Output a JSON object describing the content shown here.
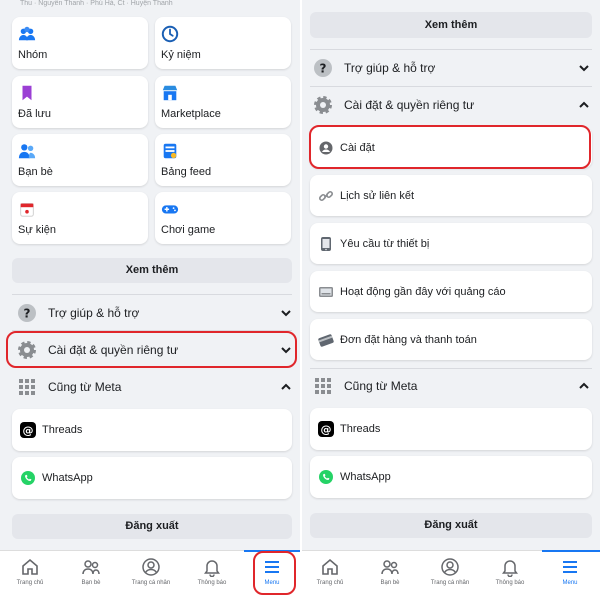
{
  "left": {
    "top_clip_text": "Thu · Nguyễn Thanh · Phú Hà, Ct · Huyện Thanh",
    "shortcuts": [
      {
        "label": "Nhóm",
        "icon": "groups-icon"
      },
      {
        "label": "Kỷ niệm",
        "icon": "memories-clock-icon"
      },
      {
        "label": "Đã lưu",
        "icon": "bookmark-icon"
      },
      {
        "label": "Marketplace",
        "icon": "marketplace-shop-icon"
      },
      {
        "label": "Bạn bè",
        "icon": "friends-icon"
      },
      {
        "label": "Bảng feed",
        "icon": "feed-icon"
      },
      {
        "label": "Sự kiện",
        "icon": "calendar-icon"
      },
      {
        "label": "Chơi game",
        "icon": "gamepad-icon"
      }
    ],
    "see_more": "Xem thêm",
    "help_support": "Trợ giúp & hỗ trợ",
    "settings_privacy": "Cài đặt & quyền riêng tư",
    "also_from_meta": "Cũng từ Meta",
    "threads": "Threads",
    "whatsapp": "WhatsApp",
    "logout": "Đăng xuất"
  },
  "right": {
    "see_more": "Xem thêm",
    "help_support": "Trợ giúp & hỗ trợ",
    "settings_privacy": "Cài đặt & quyền riêng tư",
    "settings_items": [
      {
        "label": "Cài đặt",
        "icon": "account-settings-icon"
      },
      {
        "label": "Lịch sử liên kết",
        "icon": "link-icon"
      },
      {
        "label": "Yêu cầu từ thiết bị",
        "icon": "device-icon"
      },
      {
        "label": "Hoạt động gần đây với quảng cáo",
        "icon": "ads-activity-icon"
      },
      {
        "label": "Đơn đặt hàng và thanh toán",
        "icon": "payment-card-icon"
      }
    ],
    "also_from_meta": "Cũng từ Meta",
    "threads": "Threads",
    "whatsapp": "WhatsApp",
    "logout": "Đăng xuất"
  },
  "nav": {
    "home": "Trang chủ",
    "friends": "Bạn bè",
    "profile": "Trang cá nhân",
    "notifications": "Thông báo",
    "menu": "Menu"
  },
  "colors": {
    "accent": "#1877f2",
    "highlight": "#e0262b",
    "background": "#f0f2f5"
  }
}
